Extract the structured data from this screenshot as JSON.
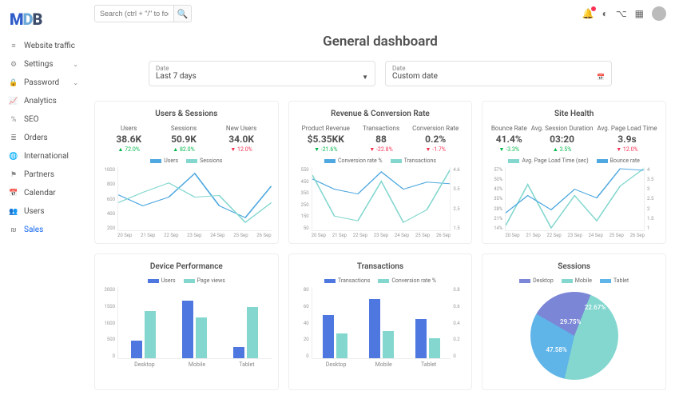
{
  "logo": {
    "m": "M",
    "d": "D",
    "b": "B"
  },
  "search": {
    "placeholder": "Search (ctrl + \"/\" to focus)"
  },
  "sidebar": {
    "items": [
      {
        "icon": "≡",
        "label": "Website traffic"
      },
      {
        "icon": "⚙",
        "label": "Settings",
        "chev": true
      },
      {
        "icon": "🔒",
        "label": "Password",
        "chev": true
      },
      {
        "icon": "📈",
        "label": "Analytics"
      },
      {
        "icon": "%",
        "label": "SEO"
      },
      {
        "icon": "≣",
        "label": "Orders"
      },
      {
        "icon": "🌐",
        "label": "International"
      },
      {
        "icon": "⚑",
        "label": "Partners"
      },
      {
        "icon": "📅",
        "label": "Calendar"
      },
      {
        "icon": "👥",
        "label": "Users"
      },
      {
        "icon": "₪",
        "label": "Sales",
        "active": true
      }
    ]
  },
  "title": "General dashboard",
  "date": {
    "label": "Date",
    "preset": "Last 7 days",
    "custom": "Custom date"
  },
  "cards": {
    "usersSessions": {
      "title": "Users & Sessions",
      "stats": [
        {
          "lbl": "Users",
          "val": "38.6K",
          "delta": "▲ 72.0%",
          "dir": "up"
        },
        {
          "lbl": "Sessions",
          "val": "50.9K",
          "delta": "▲ 82.0%",
          "dir": "up"
        },
        {
          "lbl": "New Users",
          "val": "34.0K",
          "delta": "▼ 12.0%",
          "dir": "down"
        }
      ],
      "legend": [
        {
          "name": "Users",
          "color": "#4fa8e0"
        },
        {
          "name": "Sessions",
          "color": "#83d7cf"
        }
      ]
    },
    "revenue": {
      "title": "Revenue & Conversion Rate",
      "stats": [
        {
          "lbl": "Product Revenue",
          "val": "$5.35KK",
          "delta": "▼ -21.6%",
          "dir": "up"
        },
        {
          "lbl": "Transactions",
          "val": "88",
          "delta": "▼ -22.8%",
          "dir": "down"
        },
        {
          "lbl": "Conversion Rate",
          "val": "0.2%",
          "delta": "▼ -1.7%",
          "dir": "down"
        }
      ],
      "legend": [
        {
          "name": "Conversion rate %",
          "color": "#4fa8e0"
        },
        {
          "name": "Transactions",
          "color": "#83d7cf"
        }
      ]
    },
    "siteHealth": {
      "title": "Site Health",
      "stats": [
        {
          "lbl": "Bounce Rate",
          "val": "41.4%",
          "delta": "▼ -3.3%",
          "dir": "up"
        },
        {
          "lbl": "Avg. Session Duration",
          "val": "03:20",
          "delta": "▲ 3.5%",
          "dir": "up"
        },
        {
          "lbl": "Avg. Page Load Time",
          "val": "3.9s",
          "delta": "▼ 12.0%",
          "dir": "down"
        }
      ],
      "legend": [
        {
          "name": "Avg. Page Load Time (sec)",
          "color": "#83d7cf"
        },
        {
          "name": "Bounce rate",
          "color": "#4fa8e0"
        }
      ]
    },
    "devicePerf": {
      "title": "Device Performance",
      "legend": [
        {
          "name": "Users",
          "color": "#4f77e0"
        },
        {
          "name": "Page views",
          "color": "#83d7cf"
        }
      ]
    },
    "transactions": {
      "title": "Transactions",
      "legend": [
        {
          "name": "Transactions",
          "color": "#4f77e0"
        },
        {
          "name": "Conversion rate %",
          "color": "#83d7cf"
        }
      ]
    },
    "sessions": {
      "title": "Sessions",
      "legend": [
        {
          "name": "Desktop",
          "color": "#7b87d6"
        },
        {
          "name": "Mobile",
          "color": "#83d7cf"
        },
        {
          "name": "Tablet",
          "color": "#5fb4e8"
        }
      ]
    }
  },
  "chart_data": [
    {
      "type": "line",
      "title": "Users & Sessions",
      "x": [
        "20 Sep",
        "21 Sep",
        "22 Sep",
        "23 Sep",
        "24 Sep",
        "25 Sep",
        "26 Sep"
      ],
      "series": [
        {
          "name": "Users",
          "values": [
            650,
            510,
            620,
            920,
            510,
            360,
            760
          ]
        },
        {
          "name": "Sessions",
          "values": [
            550,
            680,
            800,
            620,
            640,
            300,
            550
          ]
        }
      ],
      "ylim": [
        200,
        1000
      ],
      "yticks": [
        1000,
        800,
        600,
        400,
        200
      ]
    },
    {
      "type": "line",
      "title": "Revenue & Conversion Rate",
      "x": [
        "20 Sep",
        "21 Sep",
        "22 Sep",
        "23 Sep",
        "24 Sep",
        "25 Sep",
        "26 Sep"
      ],
      "series": [
        {
          "name": "Conversion rate %",
          "values": [
            450,
            360,
            320,
            510,
            360,
            420,
            405
          ],
          "axis": "left"
        },
        {
          "name": "Transactions",
          "values": [
            4.15,
            2.1,
            1.8,
            3.8,
            1.6,
            2.3,
            4.5
          ],
          "axis": "right"
        }
      ],
      "ylim": [
        0,
        550
      ],
      "yticks": [
        550,
        450,
        350,
        250,
        150,
        50
      ],
      "y2ticks": [
        4.6,
        3.5,
        2.5,
        1.5
      ]
    },
    {
      "type": "line",
      "title": "Site Health",
      "x": [
        "20 Sep",
        "21 Sep",
        "22 Sep",
        "23 Sep",
        "24 Sep",
        "25 Sep",
        "26 Sep"
      ],
      "series": [
        {
          "name": "Avg. Page Load Time (sec)",
          "values": [
            1.2,
            3.2,
            1.0,
            2.6,
            1.4,
            3.1,
            4.0
          ],
          "axis": "right"
        },
        {
          "name": "Bounce rate",
          "values": [
            26,
            38,
            28,
            42,
            36,
            56,
            55
          ],
          "axis": "left"
        }
      ],
      "yticks": [
        "57%",
        "50%",
        "42%",
        "35%",
        "28%",
        "21%",
        "14%"
      ],
      "y2ticks": [
        4.0,
        3.5,
        3.0,
        2.5,
        2.0,
        1.5,
        1.0
      ]
    },
    {
      "type": "bar",
      "title": "Device Performance",
      "categories": [
        "Desktop",
        "Mobile",
        "Tablet"
      ],
      "series": [
        {
          "name": "Users",
          "values": [
            510,
            1690,
            320
          ]
        },
        {
          "name": "Page views",
          "values": [
            1390,
            1190,
            1500
          ]
        }
      ],
      "ylim": [
        0,
        2000
      ],
      "yticks": [
        2000,
        1500,
        1000,
        500,
        0
      ]
    },
    {
      "type": "bar",
      "title": "Transactions",
      "categories": [
        "Desktop",
        "Mobile",
        "Tablet"
      ],
      "series": [
        {
          "name": "Transactions",
          "values": [
            51,
            70,
            46
          ]
        },
        {
          "name": "Conversion rate %",
          "values": [
            29,
            32,
            24
          ]
        }
      ],
      "ylim": [
        0,
        80
      ],
      "yticks": [
        80,
        60,
        40,
        20,
        0
      ],
      "y2lim": [
        0,
        0.8
      ],
      "y2ticks": [
        0.8,
        0.6,
        0.4,
        0.2,
        0
      ]
    },
    {
      "type": "pie",
      "title": "Sessions",
      "slices": [
        {
          "name": "Desktop",
          "value": 22.67,
          "color": "#7b87d6"
        },
        {
          "name": "Mobile",
          "value": 47.58,
          "color": "#83d7cf"
        },
        {
          "name": "Tablet",
          "value": 29.75,
          "color": "#5fb4e8"
        }
      ]
    }
  ],
  "xlabels": [
    "20 Sep",
    "21 Sep",
    "22 Sep",
    "23 Sep",
    "24 Sep",
    "25 Sep",
    "26 Sep"
  ],
  "deviceCats": [
    "Desktop",
    "Mobile",
    "Tablet"
  ]
}
